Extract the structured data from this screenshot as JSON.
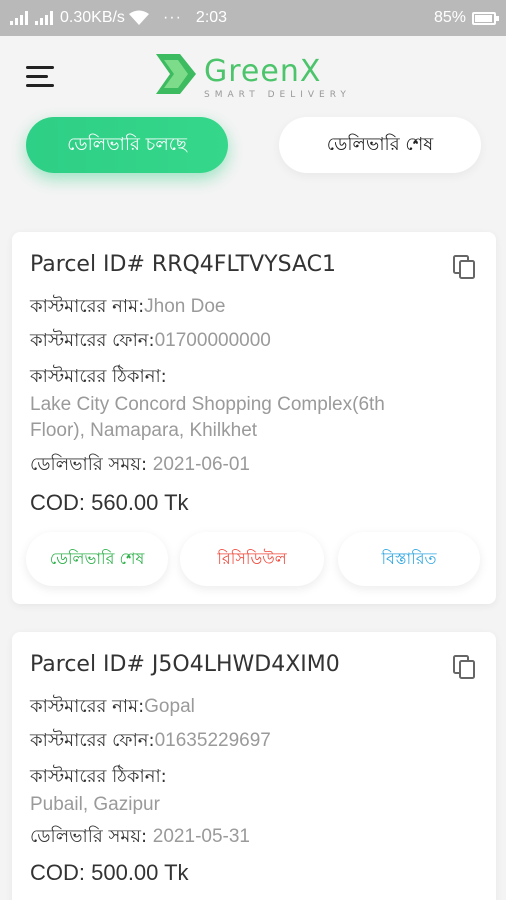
{
  "status_bar": {
    "net_speed": "0.30KB/s",
    "time": "2:03",
    "more": "···",
    "battery_percent": "85%",
    "battery_level": 0.85,
    "icons": [
      "signal-icon",
      "signal-icon",
      "wifi-icon",
      "battery-icon"
    ]
  },
  "header": {
    "menu_icon": "hamburger-icon",
    "logo": {
      "name": "GreenX",
      "tagline": "SMART DELIVERY"
    }
  },
  "tabs": [
    {
      "label": "ডেলিভারি চলছে",
      "active": true
    },
    {
      "label": "ডেলিভারি শেষ",
      "active": false
    }
  ],
  "labels": {
    "customer_name": "কাস্টমারের নাম:",
    "customer_phone": "কাস্টমারের ফোন:",
    "customer_address": "কাস্টমারের ঠিকানা:",
    "delivery_time": "ডেলিভারি সময়: "
  },
  "parcels": [
    {
      "id_text": "Parcel ID# RRQ4FLTVYSAC1",
      "name": "Jhon Doe",
      "phone": "01700000000",
      "address_line1": "Lake City Concord Shopping Complex(6th",
      "address_line2": "Floor), Namapara, Khilkhet",
      "date": "2021-06-01",
      "cod": "COD: 560.00 Tk",
      "actions": {
        "done": "ডেলিভারি শেষ",
        "reschedule": "রিসিডিউল",
        "details": "বিস্তারিত"
      }
    },
    {
      "id_text": "Parcel ID# J5O4LHWD4XIM0",
      "name": "Gopal",
      "phone": "01635229697",
      "address_line1": "Pubail, Gazipur",
      "date": "2021-05-31",
      "cod": "COD: 500.00 Tk"
    }
  ],
  "colors": {
    "brand_green": "#4cc46b",
    "active_tab": "#2ecf86",
    "done": "#2db04a",
    "reschedule": "#f04a3c",
    "details": "#2fa6e0"
  }
}
